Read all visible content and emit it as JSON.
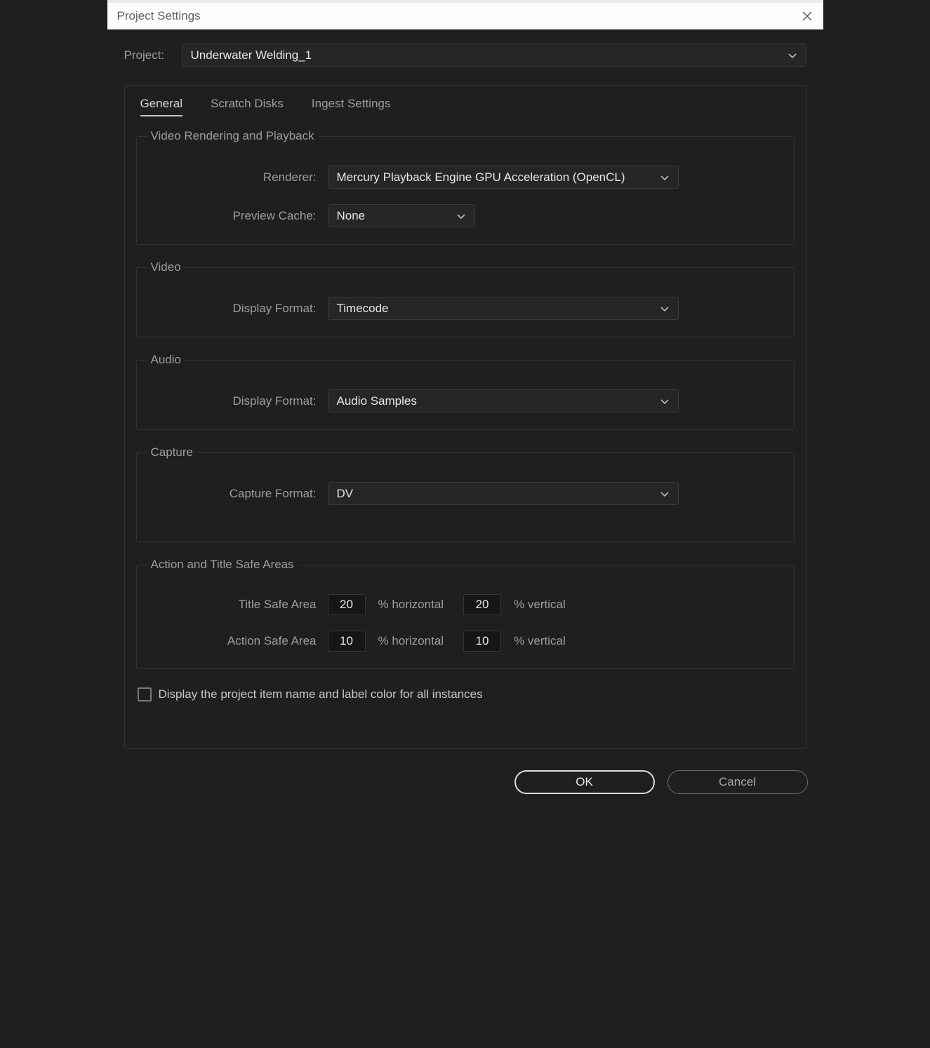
{
  "title": "Project Settings",
  "project_label": "Project:",
  "project_name": "Underwater Welding_1",
  "tabs": {
    "general": "General",
    "scratch": "Scratch Disks",
    "ingest": "Ingest Settings"
  },
  "groups": {
    "rendering": {
      "legend": "Video Rendering and Playback",
      "renderer_label": "Renderer:",
      "renderer_value": "Mercury Playback Engine GPU Acceleration (OpenCL)",
      "preview_label": "Preview Cache:",
      "preview_value": "None"
    },
    "video": {
      "legend": "Video",
      "display_label": "Display Format:",
      "display_value": "Timecode"
    },
    "audio": {
      "legend": "Audio",
      "display_label": "Display Format:",
      "display_value": "Audio Samples"
    },
    "capture": {
      "legend": "Capture",
      "capture_label": "Capture Format:",
      "capture_value": "DV"
    },
    "safe": {
      "legend": "Action and Title Safe Areas",
      "title_label": "Title Safe Area",
      "action_label": "Action Safe Area",
      "title_h": "20",
      "title_v": "20",
      "action_h": "10",
      "action_v": "10",
      "pct_h": "% horizontal",
      "pct_v": "% vertical"
    }
  },
  "display_all_instances_label": "Display the project item name and label color for all instances",
  "buttons": {
    "ok": "OK",
    "cancel": "Cancel"
  }
}
